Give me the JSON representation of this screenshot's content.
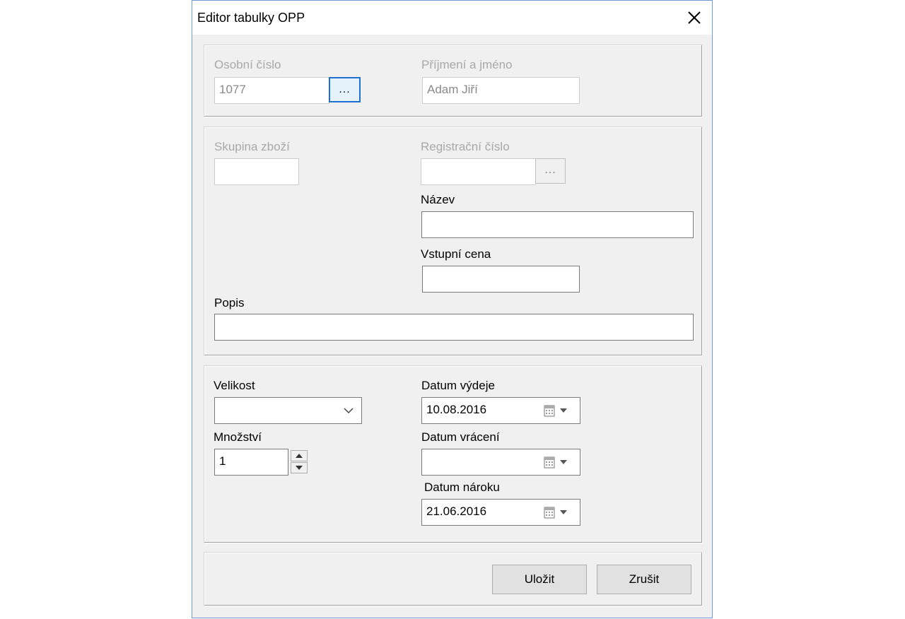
{
  "window": {
    "title": "Editor tabulky OPP"
  },
  "employee": {
    "number_label": "Osobní číslo",
    "number_value": "1077",
    "picker_label": "...",
    "name_label": "Příjmení a jméno",
    "name_value": "Adam Jiří"
  },
  "goods": {
    "group_label": "Skupina zboží",
    "group_value": "",
    "reg_label": "Registrační číslo",
    "reg_value": "",
    "reg_picker_label": "...",
    "name_label": "Název",
    "name_value": "",
    "price_label": "Vstupní cena",
    "price_value": "",
    "desc_label": "Popis",
    "desc_value": ""
  },
  "issue": {
    "size_label": "Velikost",
    "size_value": "",
    "qty_label": "Množství",
    "qty_value": "1",
    "issue_date_label": "Datum výdeje",
    "issue_date_value": "10.08.2016",
    "return_date_label": "Datum vrácení",
    "return_date_value": "",
    "claim_date_label": "Datum nároku",
    "claim_date_value": "21.06.2016"
  },
  "actions": {
    "save_label": "Uložit",
    "cancel_label": "Zrušit"
  },
  "icons": {
    "close": "close-icon",
    "calendar": "calendar-icon",
    "chevron": "chevron-down-icon"
  },
  "colors": {
    "focus": "#1f6fd0",
    "window_border": "#6f9ad6",
    "disabled_text": "#a8a8a8"
  }
}
